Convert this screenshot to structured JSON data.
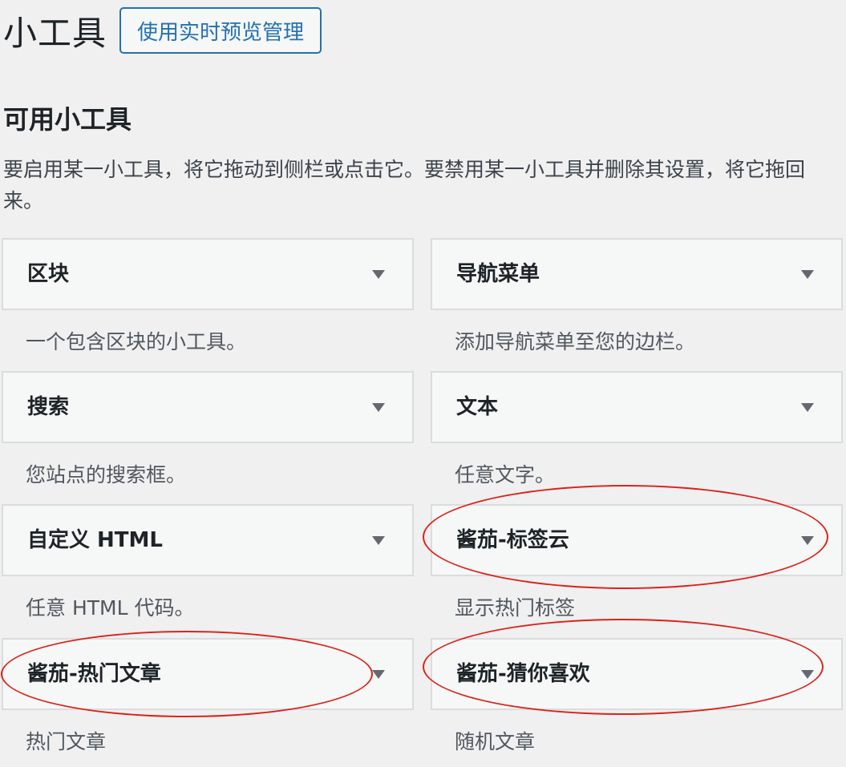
{
  "page": {
    "title": "小工具",
    "preview_button": "使用实时预览管理"
  },
  "available": {
    "heading": "可用小工具",
    "description": "要启用某一小工具，将它拖动到侧栏或点击它。要禁用某一小工具并删除其设置，将它拖回来。"
  },
  "widgets": [
    {
      "title": "区块",
      "description": "一个包含区块的小工具。"
    },
    {
      "title": "导航菜单",
      "description": "添加导航菜单至您的边栏。"
    },
    {
      "title": "搜索",
      "description": "您站点的搜索框。"
    },
    {
      "title": "文本",
      "description": "任意文字。"
    },
    {
      "title": "自定义 HTML",
      "description": "任意 HTML 代码。"
    },
    {
      "title": "酱茄-标签云",
      "description": "显示热门标签"
    },
    {
      "title": "酱茄-热门文章",
      "description": "热门文章"
    },
    {
      "title": "酱茄-猜你喜欢",
      "description": "随机文章"
    }
  ],
  "colors": {
    "highlight": "#d9231a",
    "accent": "#2271b1"
  },
  "icons": {
    "widget_toggle": "triangle-down-icon"
  }
}
